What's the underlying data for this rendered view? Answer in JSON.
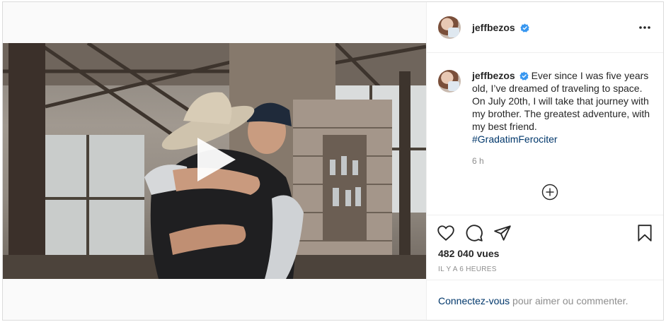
{
  "post": {
    "username": "jeffbezos",
    "caption_text": " Ever since I was five years old, I’ve dreamed of traveling to space. On July 20th, I will take that journey with my brother. The greatest adventure, with my best friend.",
    "hashtag": "#GradatimFerociter",
    "caption_time": "6 h",
    "views": "482 040 vues",
    "posted_ago": "IL Y A 6 HEURES"
  },
  "login": {
    "link_text": "Connectez-vous",
    "rest_text": " pour aimer ou commenter."
  },
  "icons": {
    "verified": "verified-badge-icon",
    "more": "more-options-icon",
    "load_more": "plus-circle-icon",
    "like": "heart-icon",
    "comment": "comment-icon",
    "share": "paper-plane-icon",
    "save": "bookmark-icon",
    "play": "play-icon"
  },
  "colors": {
    "verified": "#3897f0",
    "link": "#00376b",
    "muted": "#8e8e8e",
    "text": "#262626",
    "border": "#dbdbdb"
  }
}
